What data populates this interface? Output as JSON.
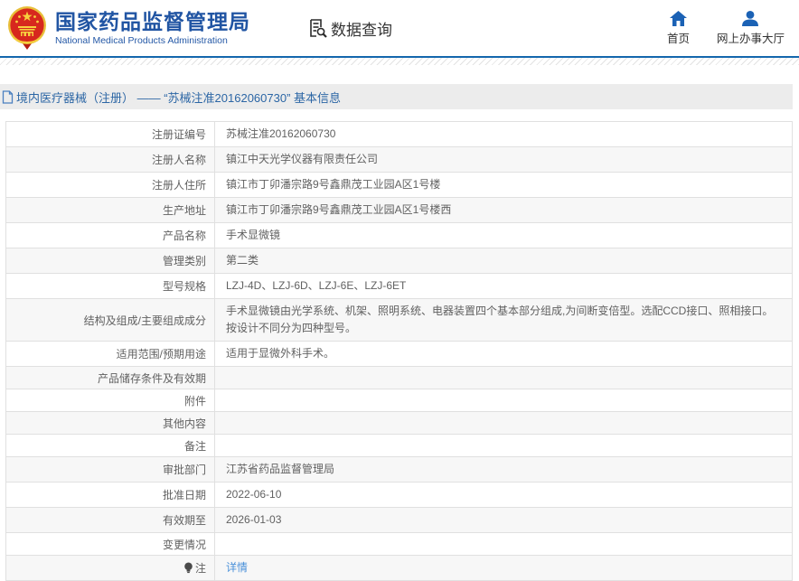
{
  "header": {
    "org_name_cn": "国家药品监督管理局",
    "org_name_en": "National Medical Products Administration",
    "data_query_label": "数据查询",
    "nav": [
      {
        "label": "首页",
        "icon": "home-icon"
      },
      {
        "label": "网上办事大厅",
        "icon": "user-icon"
      }
    ]
  },
  "breadcrumb": {
    "text": "境内医疗器械（注册） —— “苏械注准20162060730” 基本信息"
  },
  "table": {
    "rows": [
      {
        "label": "注册证编号",
        "value": "苏械注准20162060730"
      },
      {
        "label": "注册人名称",
        "value": "镇江中天光学仪器有限责任公司"
      },
      {
        "label": "注册人住所",
        "value": "镇江市丁卯潘宗路9号鑫鼎茂工业园A区1号楼"
      },
      {
        "label": "生产地址",
        "value": "镇江市丁卯潘宗路9号鑫鼎茂工业园A区1号楼西"
      },
      {
        "label": "产品名称",
        "value": "手术显微镜"
      },
      {
        "label": "管理类别",
        "value": "第二类"
      },
      {
        "label": "型号规格",
        "value": "LZJ-4D、LZJ-6D、LZJ-6E、LZJ-6ET"
      },
      {
        "label": "结构及组成/主要组成成分",
        "value": "手术显微镜由光学系统、机架、照明系统、电器装置四个基本部分组成,为间断变倍型。选配CCD接口、照相接口。按设计不同分为四种型号。"
      },
      {
        "label": "适用范围/预期用途",
        "value": "适用于显微外科手术。"
      },
      {
        "label": "产品储存条件及有效期",
        "value": ""
      },
      {
        "label": "附件",
        "value": ""
      },
      {
        "label": "其他内容",
        "value": ""
      },
      {
        "label": "备注",
        "value": ""
      },
      {
        "label": "审批部门",
        "value": "江苏省药品监督管理局"
      },
      {
        "label": "批准日期",
        "value": "2022-06-10"
      },
      {
        "label": "有效期至",
        "value": "2026-01-03"
      },
      {
        "label": "变更情况",
        "value": ""
      },
      {
        "label": "注",
        "value": "详情",
        "link": true,
        "icon": "bulb-icon"
      }
    ]
  },
  "colors": {
    "brand_blue": "#2155a3",
    "icon_blue": "#1b62b5",
    "link_blue": "#4a90d9",
    "top_line_blue": "#1467ad",
    "emblem_red": "#d7281e",
    "emblem_gold": "#e8bf3a",
    "breadcrumb_bg": "#ececec",
    "row_alt_bg": "#f7f7f7",
    "border_gray": "#e0e0e0",
    "text_gray": "#616161"
  }
}
